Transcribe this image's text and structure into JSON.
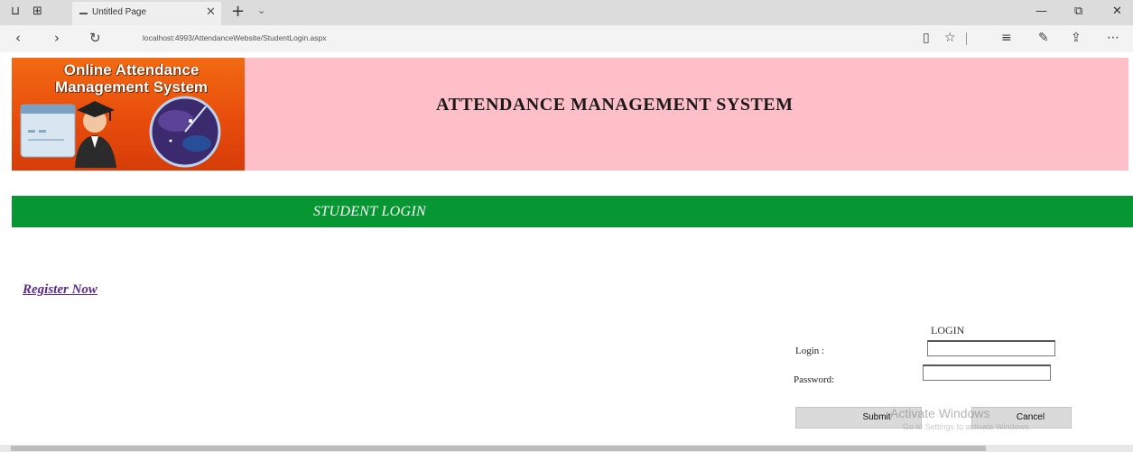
{
  "browser": {
    "tab_title": "Untitled Page",
    "url": "localhost:4993/AttendanceWebsite/StudentLogin.aspx",
    "icons": {
      "tab_actions": [
        "tabs-aside-icon",
        "tab-preview-icon"
      ],
      "close_tab": "close-icon",
      "new_tab": "plus-icon",
      "tab_list": "chevron-down-icon",
      "window": [
        "minimize-icon",
        "restore-icon",
        "close-icon"
      ],
      "nav": [
        "back-icon",
        "forward-icon",
        "refresh-icon"
      ],
      "tools": [
        "reading-view-icon",
        "favorite-star-icon",
        "hub-icon",
        "pen-icon",
        "share-icon",
        "more-icon"
      ]
    }
  },
  "header": {
    "logo_text": "Online Attendance Management System",
    "title": "ATTENDANCE MANAGEMENT SYSTEM",
    "background": "#ffbfc9"
  },
  "banner": {
    "title": "STUDENT LOGIN",
    "background": "#069632"
  },
  "register_link": "Register Now",
  "login_form": {
    "heading": "LOGIN",
    "login_label": "Login :",
    "login_value": "",
    "password_label": "Password:",
    "password_value": "",
    "submit_label": "Submit",
    "cancel_label": "Cancel"
  },
  "watermark": {
    "line1": "Activate Windows",
    "line2": "Go to Settings to activate Windows."
  },
  "colors": {
    "link": "#5b2a86"
  }
}
